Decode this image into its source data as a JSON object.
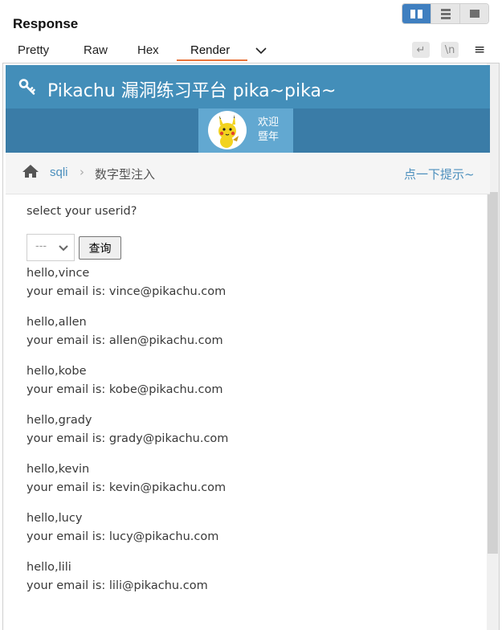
{
  "panel": {
    "title": "Response",
    "tabs": [
      "Pretty",
      "Raw",
      "Hex",
      "Render"
    ],
    "active_tab": "Render",
    "tool_wrap": "↵",
    "tool_newline": "\\n",
    "menu": "≡"
  },
  "colors": {
    "accent_tab": "#e8743b",
    "navbar": "#438eb9",
    "subbar": "#3a7ca7",
    "link": "#4c8fbd",
    "toggle_active": "#3f7fc0"
  },
  "page": {
    "brand": "Pikachu 漏洞练习平台 pika~pika~",
    "welcome_line1": "欢迎",
    "welcome_line2": "暨年",
    "breadcrumb_link": "sqli",
    "breadcrumb_current": "数字型注入",
    "hint": "点一下提示~",
    "prompt": "select your userid?",
    "select_value": "---",
    "query_button": "查询",
    "results": [
      {
        "hello": "hello,vince",
        "email": "your email is: vince@pikachu.com"
      },
      {
        "hello": "hello,allen",
        "email": "your email is: allen@pikachu.com"
      },
      {
        "hello": "hello,kobe",
        "email": "your email is: kobe@pikachu.com"
      },
      {
        "hello": "hello,grady",
        "email": "your email is: grady@pikachu.com"
      },
      {
        "hello": "hello,kevin",
        "email": "your email is: kevin@pikachu.com"
      },
      {
        "hello": "hello,lucy",
        "email": "your email is: lucy@pikachu.com"
      },
      {
        "hello": "hello,lili",
        "email": "your email is: lili@pikachu.com"
      }
    ]
  },
  "icons": {
    "brand": "key-icon",
    "breadcrumb": "home-icon",
    "select": "chevron-down-icon"
  }
}
